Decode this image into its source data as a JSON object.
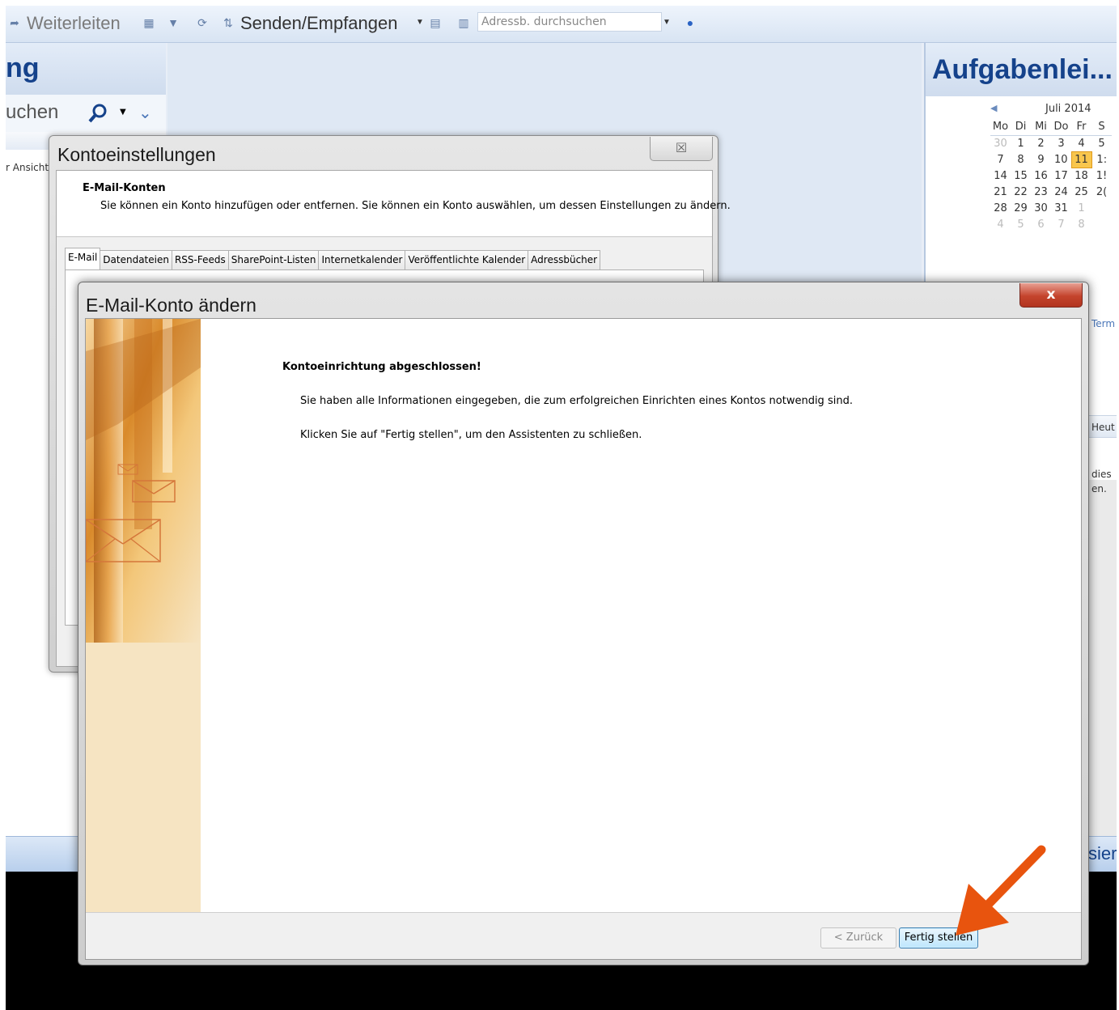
{
  "toolbar": {
    "forward_label": "Weiterleiten",
    "send_receive_label": "Senden/Empfangen",
    "addressbook_placeholder": "Adressb. durchsuchen",
    "icons": [
      "forward-icon",
      "save-icon",
      "filter-icon",
      "sync-icon",
      "send-receive-icon",
      "folder-icon",
      "addressbook-icon",
      "help-icon"
    ]
  },
  "mail_pane": {
    "title": "ng",
    "search_text": "uchen",
    "view_label": "r Ansicht"
  },
  "todo_pane": {
    "title": "Aufgabenlei...",
    "calendar": {
      "month": "Juli 2014",
      "weekdays": [
        "Mo",
        "Di",
        "Mi",
        "Do",
        "Fr",
        "S"
      ],
      "weeks": [
        [
          "30",
          "1",
          "2",
          "3",
          "4",
          "5"
        ],
        [
          "7",
          "8",
          "9",
          "10",
          "11",
          "1:"
        ],
        [
          "14",
          "15",
          "16",
          "17",
          "18",
          "1!"
        ],
        [
          "21",
          "22",
          "23",
          "24",
          "25",
          "2("
        ],
        [
          "28",
          "29",
          "30",
          "31",
          "1",
          ""
        ],
        [
          "4",
          "5",
          "6",
          "7",
          "8",
          ""
        ]
      ],
      "today": "11"
    },
    "appointments_label": "Term",
    "today_label": "Heut",
    "note_line1": "dies",
    "note_line2": "en."
  },
  "nav_strip": {
    "label": "sier"
  },
  "account_settings_dialog": {
    "title": "Kontoeinstellungen",
    "header_title": "E-Mail-Konten",
    "header_text": "Sie können ein Konto hinzufügen oder entfernen. Sie können ein Konto auswählen, um dessen Einstellungen zu ändern.",
    "tabs": [
      "E-Mail",
      "Datendateien",
      "RSS-Feeds",
      "SharePoint-Listen",
      "Internetkalender",
      "Veröffentlichte Kalender",
      "Adressbücher"
    ],
    "close_glyph": "☒"
  },
  "change_account_dialog": {
    "title": "E-Mail-Konto ändern",
    "heading": "Kontoeinrichtung abgeschlossen!",
    "text1": "Sie haben alle Informationen eingegeben, die zum erfolgreichen Einrichten eines Kontos notwendig sind.",
    "text2": "Klicken Sie auf \"Fertig stellen\", um den Assistenten zu schließen.",
    "back_label": "< Zurück",
    "finish_label": "Fertig stellen",
    "close_glyph": "x"
  },
  "colors": {
    "accent": "#15428b",
    "arrow": "#e8540e",
    "close_red": "#c4442d"
  }
}
